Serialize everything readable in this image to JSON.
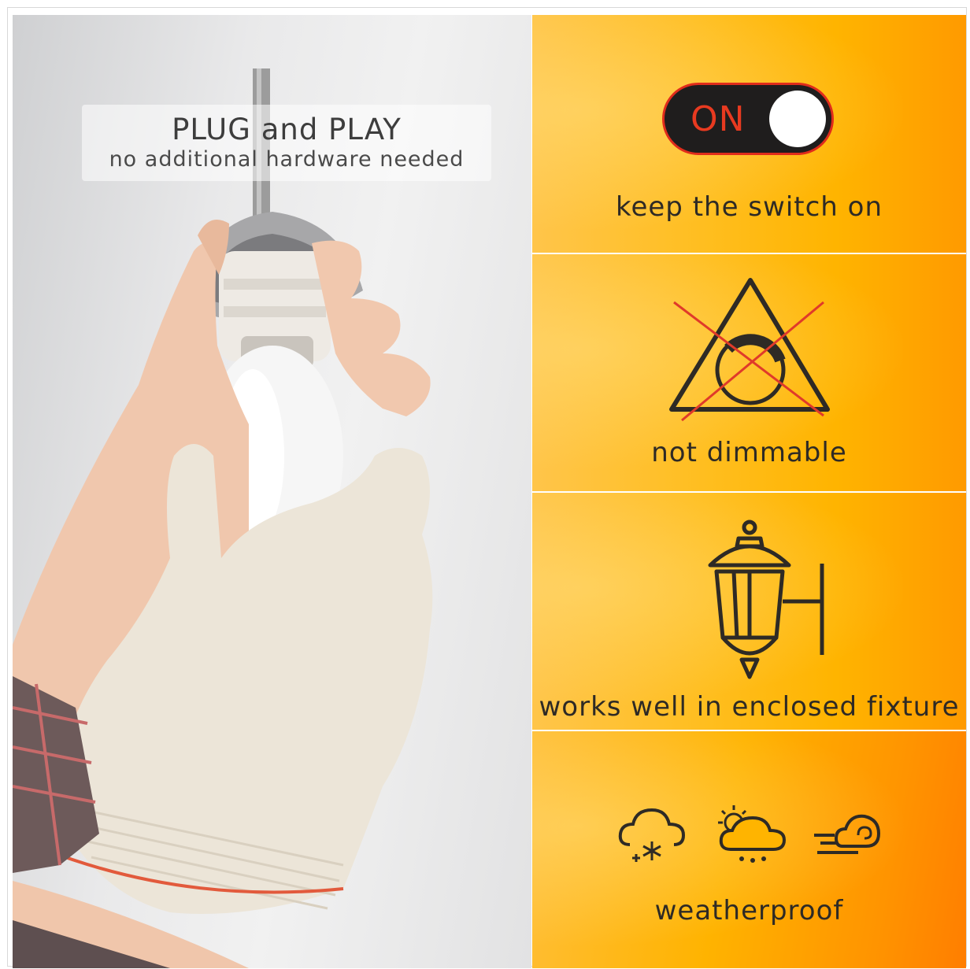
{
  "photo": {
    "caption_title": "PLUG and PLAY",
    "caption_subtitle": "no additional hardware needed"
  },
  "features": [
    {
      "id": "switch",
      "label": "keep the switch on",
      "toggle_text": "ON",
      "icon": "toggle-switch-icon"
    },
    {
      "id": "dim",
      "label": "not dimmable",
      "icon": "no-dimmer-icon"
    },
    {
      "id": "fixture",
      "label": "works well in enclosed fixture",
      "icon": "wall-lantern-icon"
    },
    {
      "id": "weather",
      "label": "weatherproof",
      "icons": [
        "snow-cloud-icon",
        "sun-rain-cloud-icon",
        "wind-cloud-icon"
      ]
    }
  ],
  "colors": {
    "panel": "#ffb400",
    "toggle_border": "#e02c1b",
    "cross": "#e03a2a",
    "ink": "#2e2a25"
  }
}
